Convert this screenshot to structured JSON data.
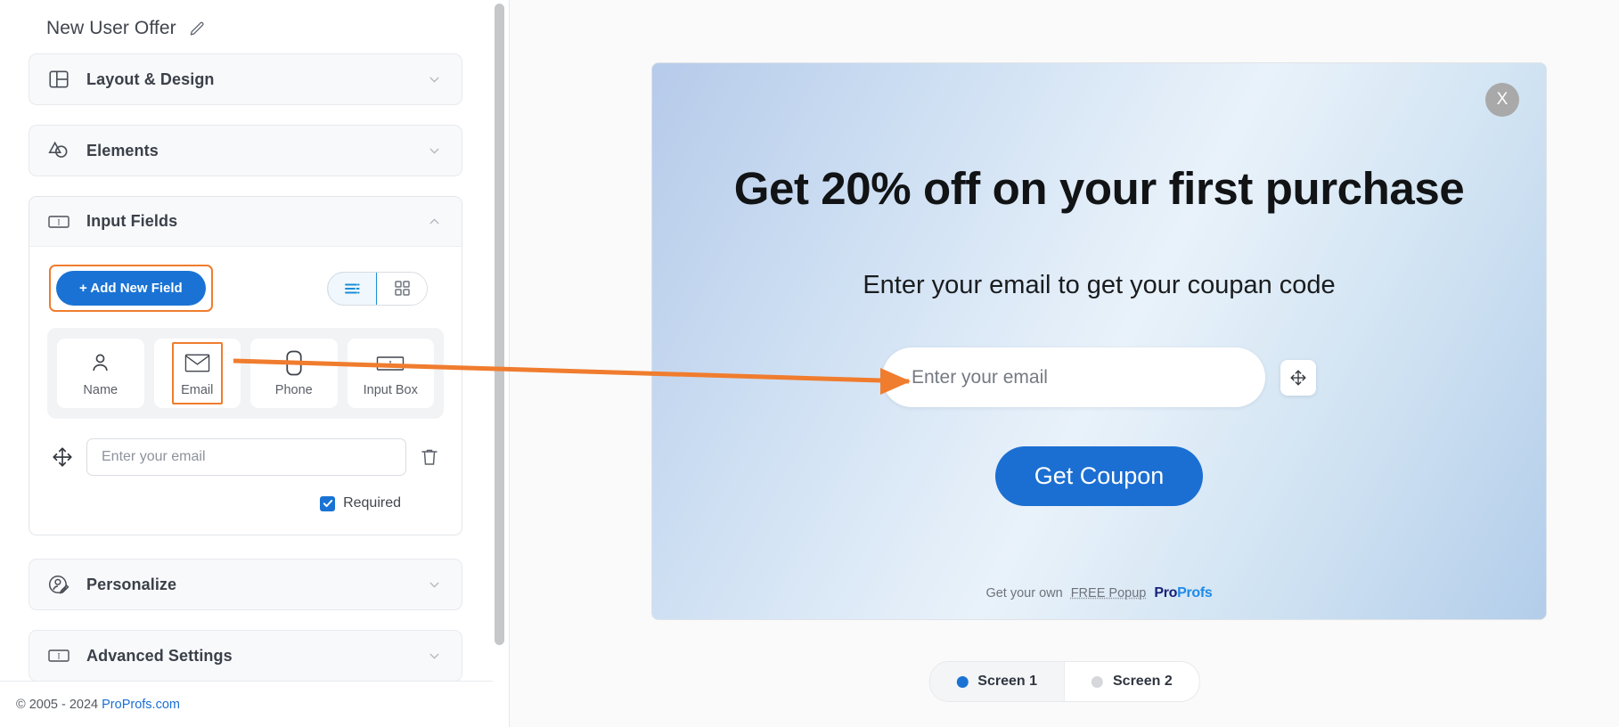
{
  "sidebar": {
    "project_title": "New User Offer",
    "edit_icon": "pencil-icon",
    "sections": [
      {
        "label": "Layout & Design",
        "icon": "layout-icon",
        "expanded": false
      },
      {
        "label": "Elements",
        "icon": "shapes-icon",
        "expanded": false
      },
      {
        "label": "Input Fields",
        "icon": "input-box-icon",
        "expanded": true
      },
      {
        "label": "Personalize",
        "icon": "personalize-icon",
        "expanded": false
      },
      {
        "label": "Advanced Settings",
        "icon": "input-box-icon",
        "expanded": false
      }
    ],
    "input_fields": {
      "add_button_label": "+ Add New Field",
      "view_toggle": {
        "options": [
          "list-view",
          "grid-view"
        ],
        "selected": "list-view"
      },
      "field_types": [
        {
          "label": "Name",
          "icon": "user-icon",
          "selected": false
        },
        {
          "label": "Email",
          "icon": "envelope-icon",
          "selected": true
        },
        {
          "label": "Phone",
          "icon": "phone-icon",
          "selected": false
        },
        {
          "label": "Input Box",
          "icon": "input-box-icon",
          "selected": false
        }
      ],
      "field_row": {
        "drag_handle_icon": "move-icon",
        "value": "",
        "placeholder": "Enter your email",
        "delete_icon": "trash-icon",
        "required_label": "Required",
        "required_checked": true
      }
    },
    "footer": {
      "copyright": "© 2005 - 2024 ",
      "link": "ProProfs.com"
    }
  },
  "canvas": {
    "popup": {
      "close_label": "X",
      "headline": "Get 20% off on your first purchase",
      "subheadline": "Enter your email to get your coupan code",
      "email_placeholder": "Enter your email",
      "email_value": "",
      "move_icon": "move-icon",
      "cta_label": "Get Coupon",
      "branding": {
        "prefix": "Get your own",
        "link": "FREE Popup",
        "logo_first": "Pro",
        "logo_second": "Profs"
      }
    },
    "screens": [
      {
        "label": "Screen 1",
        "active": true
      },
      {
        "label": "Screen 2",
        "active": false
      }
    ]
  },
  "annotations": {
    "highlight_color": "#f07c2e",
    "arrow_from": "Email field type card",
    "arrow_to": "Popup email input"
  },
  "colors": {
    "accent_blue": "#1a73d4",
    "highlight_orange": "#f07c2e",
    "popup_gradient_start": "#b6cbea",
    "popup_gradient_end": "#b3cdea"
  }
}
